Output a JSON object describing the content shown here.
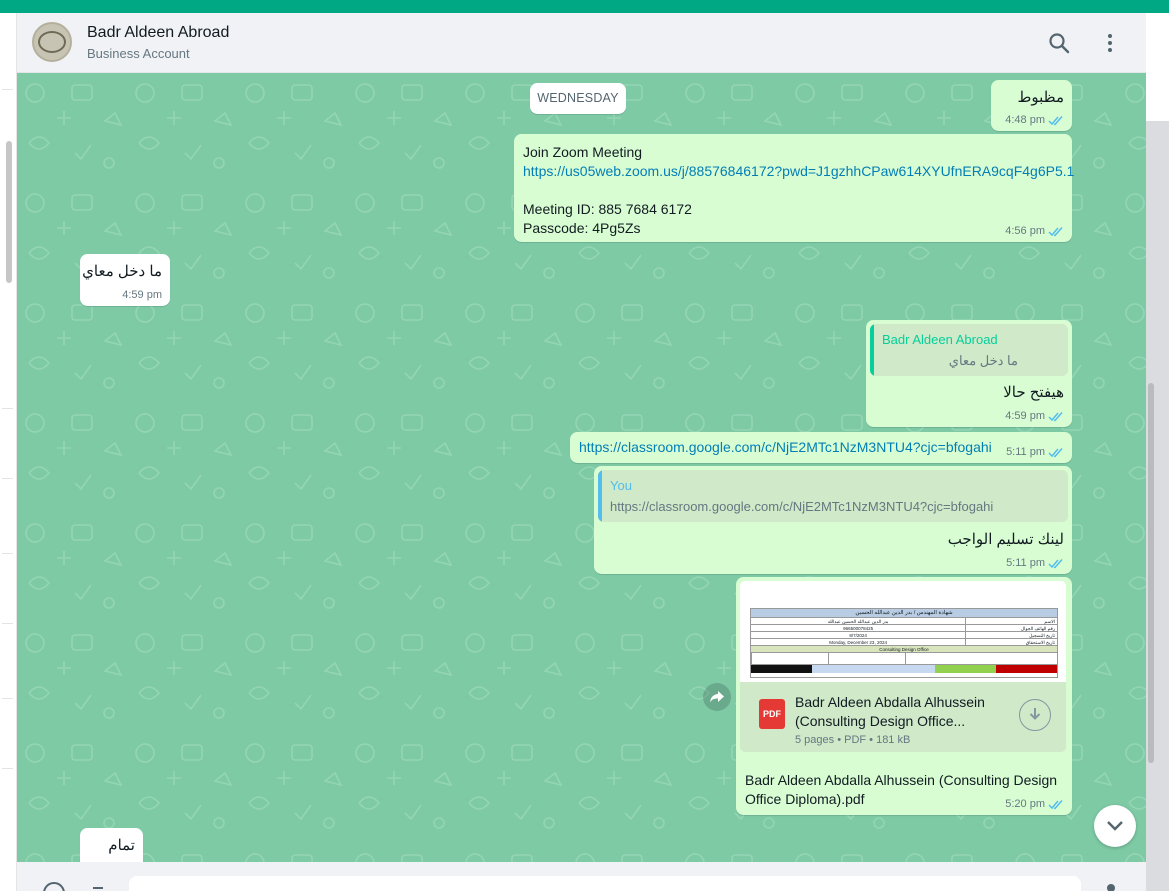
{
  "header": {
    "name": "Badr Aldeen Abroad",
    "subtitle": "Business Account"
  },
  "date_divider": "WEDNESDAY",
  "messages": [
    {
      "id": "m1",
      "direction": "out",
      "text": "مظبوط",
      "time": "4:48 pm"
    },
    {
      "id": "m2",
      "direction": "out",
      "line1": "Join Zoom Meeting",
      "link": "https://us05web.zoom.us/j/88576846172?pwd=J1gzhhCPaw614XYUfnERA9cqF4g6P5.1",
      "line3": "Meeting ID: 885 7684 6172",
      "line4": "Passcode: 4Pg5Zs",
      "time": "4:56 pm"
    },
    {
      "id": "m3",
      "direction": "in",
      "text": "ما دخل معاي",
      "time": "4:59 pm"
    },
    {
      "id": "m4",
      "direction": "out",
      "quote_author": "Badr Aldeen Abroad",
      "quote_text": "ما دخل معاي",
      "text": "هيفتح حالا",
      "time": "4:59 pm"
    },
    {
      "id": "m5",
      "direction": "out",
      "link": "https://classroom.google.com/c/NjE2MTc1NzM3NTU4?cjc=bfogahi",
      "time": "5:11 pm"
    },
    {
      "id": "m6",
      "direction": "out",
      "quote_author": "You",
      "quote_text": "https://classroom.google.com/c/NjE2MTc1NzM3NTU4?cjc=bfogahi",
      "text": "لينك تسليم الواجب",
      "time": "5:11 pm"
    },
    {
      "id": "m7",
      "direction": "out",
      "doc_badge": "PDF",
      "doc_title": "Badr Aldeen Abdalla Alhussein (Consulting Design Office...",
      "doc_info": "5 pages • PDF • 181 kB",
      "caption": "Badr Aldeen Abdalla Alhussein (Consulting Design Office Diploma).pdf",
      "time": "5:20 pm"
    },
    {
      "id": "m8",
      "direction": "in",
      "text": "تمام"
    }
  ],
  "doc_preview": {
    "title": "شهادة المهندس / بدر الدين عبدالله الحسين",
    "rows": [
      {
        "label": "الاسم",
        "value": "بدر الدين عبدالله الحسين عبدالله"
      },
      {
        "label": "رقم الهاتف الجوال",
        "value": "966500078425"
      },
      {
        "label": "تاريخ التسجيل",
        "value": "8/7/2024"
      },
      {
        "label": "تاريخ الاستحقاق",
        "value": "Monday, December 23, 2024"
      }
    ],
    "section": "Consulting Design Office"
  },
  "footer": {
    "input_placeholder": ""
  },
  "colors": {
    "accent": "#00a884",
    "chat_bg": "#7ecaa5",
    "outgoing": "#d9fdd3",
    "incoming": "#ffffff",
    "link": "#027eb5",
    "tick_read": "#53bdeb"
  }
}
